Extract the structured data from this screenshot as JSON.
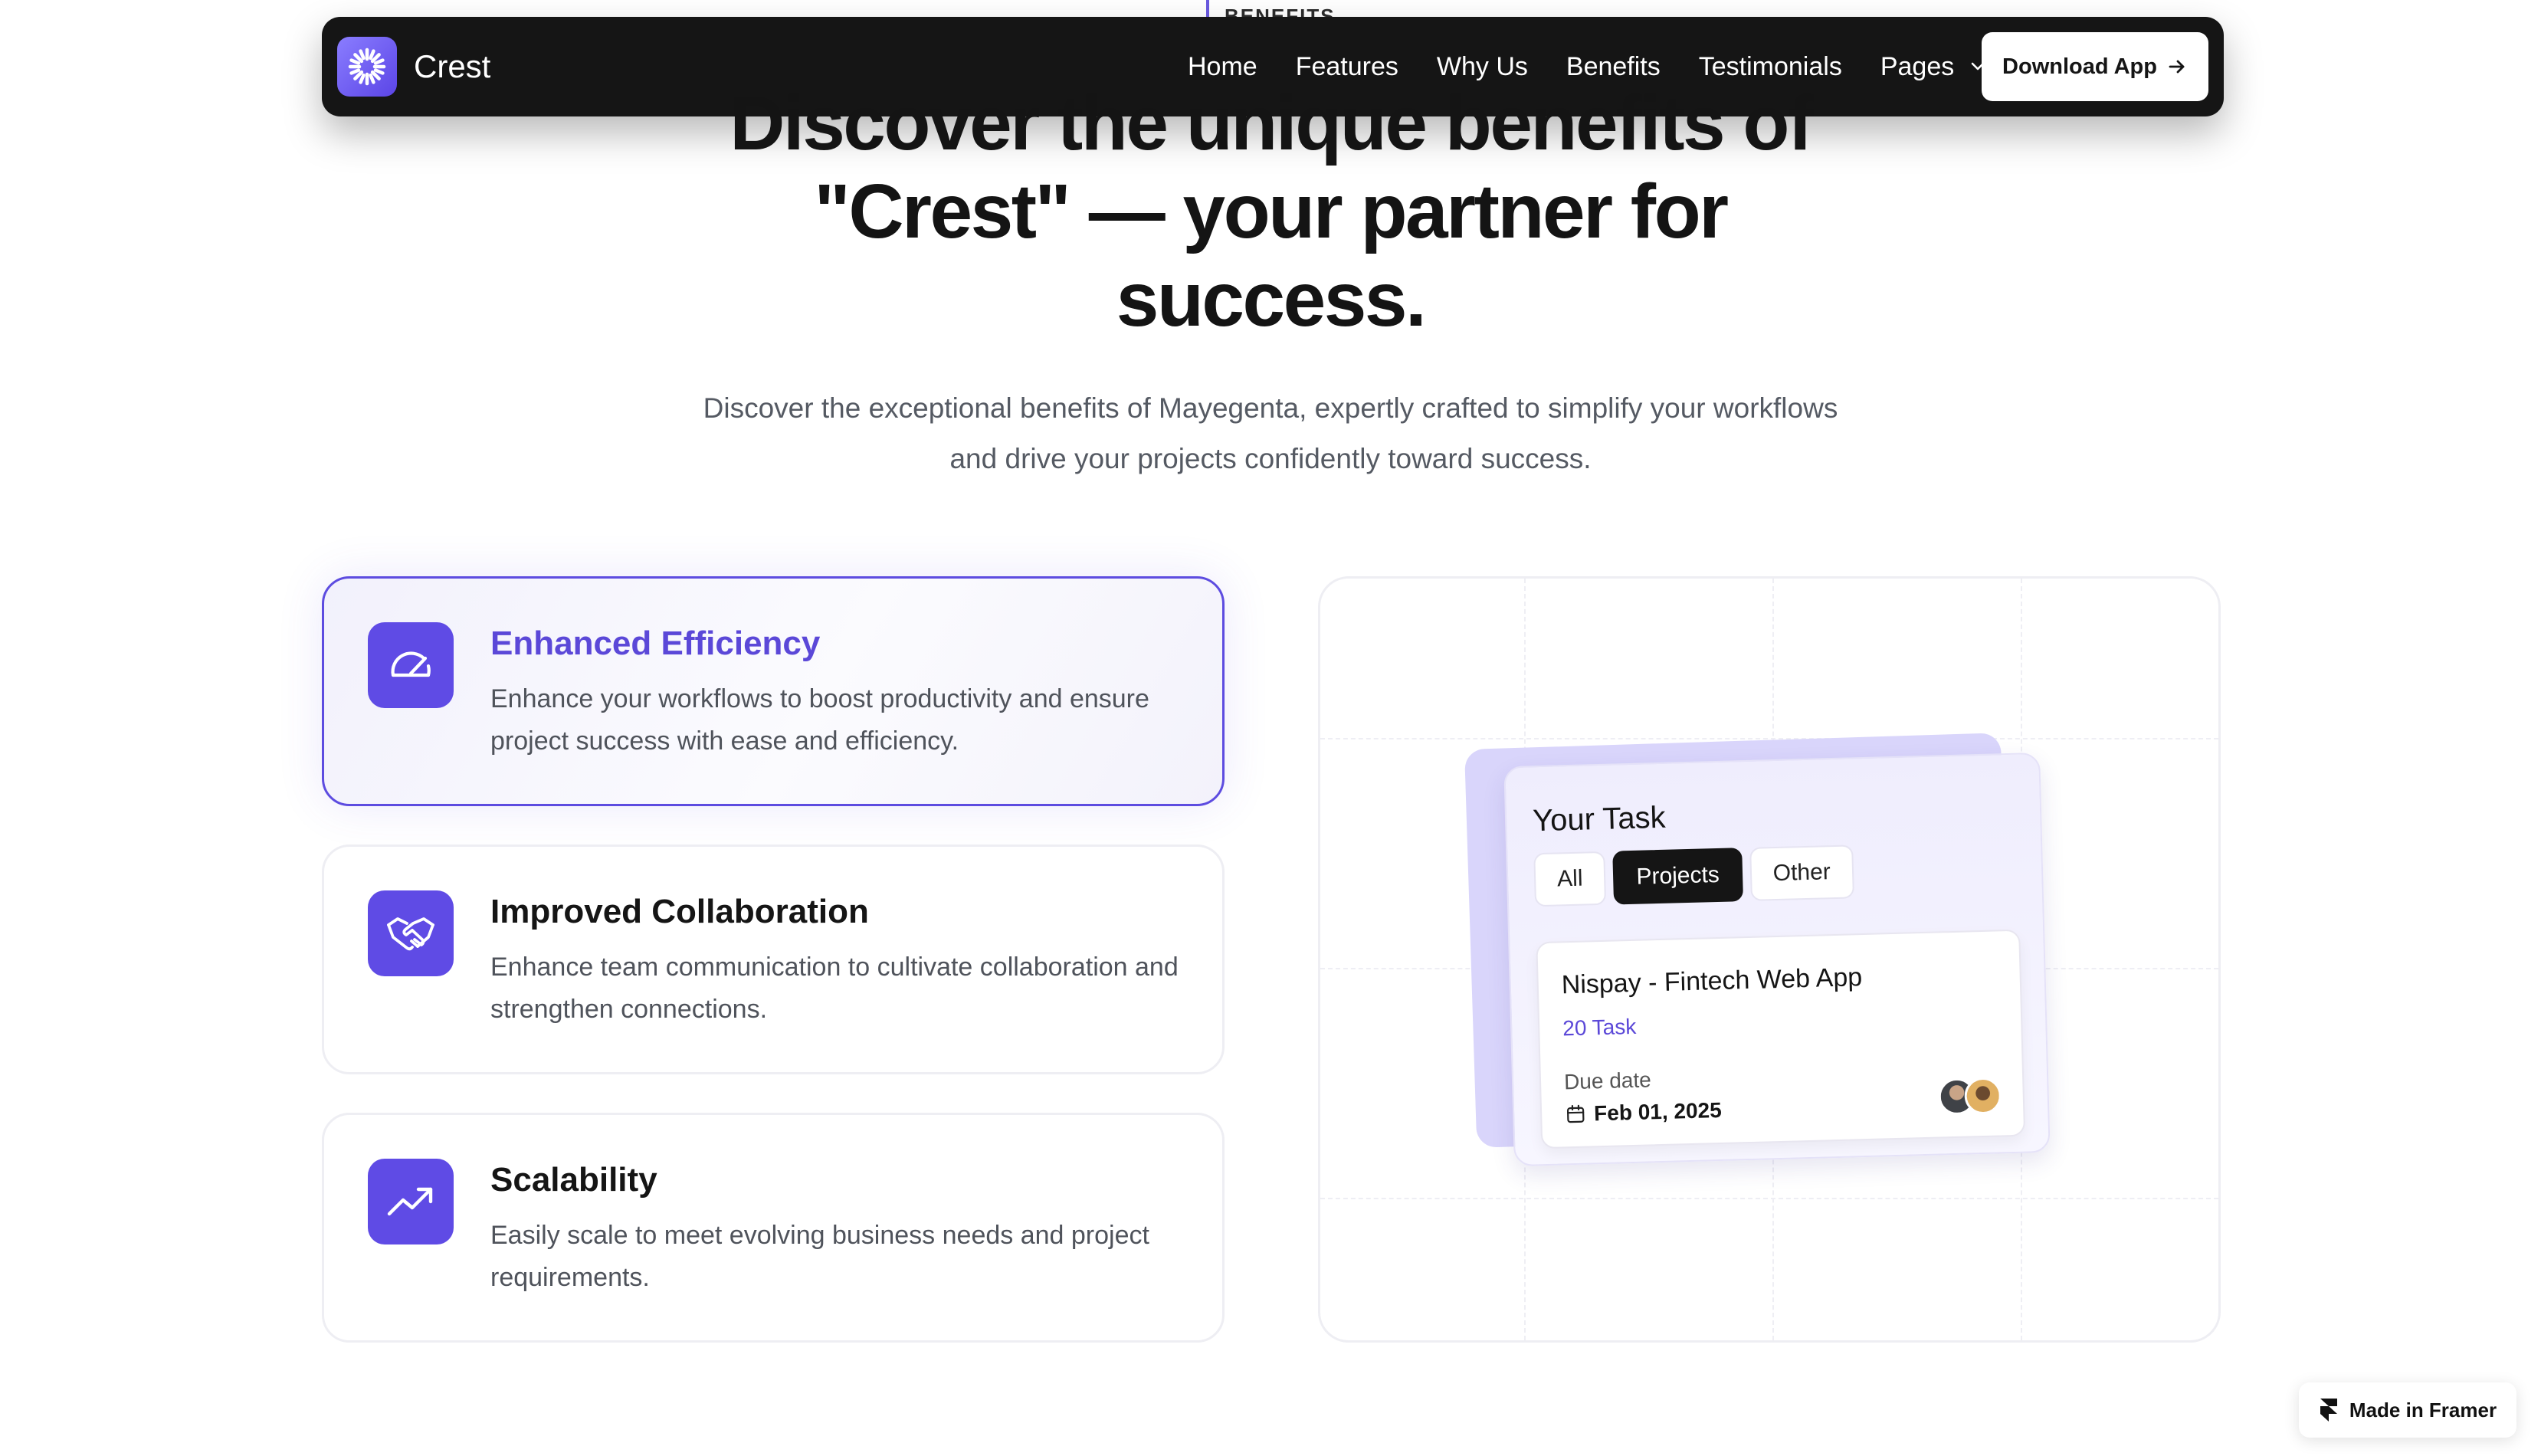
{
  "section": {
    "label": "BENEFITS"
  },
  "nav": {
    "brand": "Crest",
    "links": [
      "Home",
      "Features",
      "Why Us",
      "Benefits",
      "Testimonials",
      "Pages"
    ],
    "cta": "Download App"
  },
  "hero": {
    "title": "Discover the unique benefits of \"Crest\" — your partner for success.",
    "subtitle": "Discover the exceptional benefits of Mayegenta, expertly crafted to simplify your workflows and drive your projects confidently toward success."
  },
  "benefits": [
    {
      "title": "Enhanced Efficiency",
      "description": "Enhance your workflows to boost productivity and ensure project success with ease and efficiency.",
      "icon": "speedometer-icon",
      "active": true
    },
    {
      "title": "Improved Collaboration",
      "description": "Enhance team communication to cultivate collaboration and strengthen connections.",
      "icon": "handshake-icon",
      "active": false
    },
    {
      "title": "Scalability",
      "description": "Easily scale to meet evolving business needs and project requirements.",
      "icon": "trending-up-icon",
      "active": false
    }
  ],
  "task_widget": {
    "heading": "Your Task",
    "tabs": [
      "All",
      "Projects",
      "Other"
    ],
    "selected_tab": "Projects",
    "project": {
      "name": "Nispay - Fintech Web App",
      "count": "20 Task",
      "due_label": "Due date",
      "due_date": "Feb 01, 2025"
    }
  },
  "badge": {
    "label": "Made in Framer"
  },
  "colors": {
    "accent": "#5f4be5",
    "nav_bg": "#151515",
    "active_title": "#5b48d8"
  }
}
